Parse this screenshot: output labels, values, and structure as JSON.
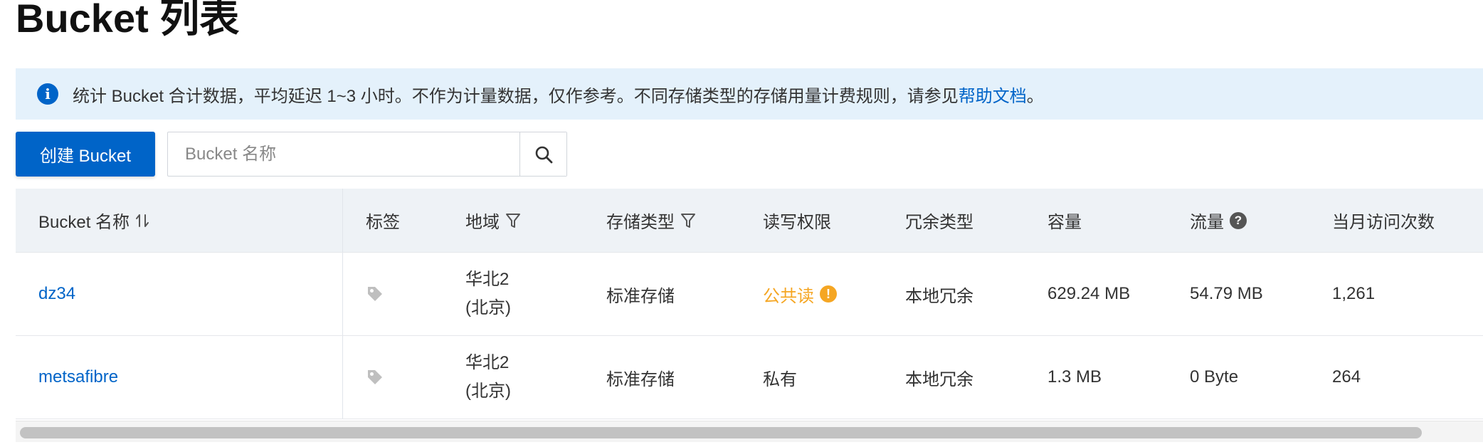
{
  "page_title": "Bucket 列表",
  "notice": {
    "text": "统计 Bucket 合计数据，平均延迟 1~3 小时。不作为计量数据，仅作参考。不同存储类型的存储用量计费规则，请参见",
    "link_text": "帮助文档",
    "suffix": "。",
    "icon": "info-icon"
  },
  "toolbar": {
    "create_label": "创建 Bucket",
    "search_placeholder": "Bucket 名称",
    "search_icon": "search-icon"
  },
  "table": {
    "columns": {
      "name": "Bucket 名称",
      "tag": "标签",
      "region": "地域",
      "storage_class": "存储类型",
      "acl": "读写权限",
      "redundancy": "冗余类型",
      "capacity": "容量",
      "traffic": "流量",
      "monthly_visits": "当月访问次数"
    },
    "rows": [
      {
        "name": "dz34",
        "region": "华北2 (北京)",
        "storage_class": "标准存储",
        "acl": "公共读",
        "acl_warning": true,
        "redundancy": "本地冗余",
        "capacity": "629.24 MB",
        "traffic": "54.79 MB",
        "monthly_visits": "1,261"
      },
      {
        "name": "metsafibre",
        "region": "华北2 (北京)",
        "storage_class": "标准存储",
        "acl": "私有",
        "acl_warning": false,
        "redundancy": "本地冗余",
        "capacity": "1.3 MB",
        "traffic": "0 Byte",
        "monthly_visits": "264"
      }
    ]
  },
  "colors": {
    "primary": "#0064c8",
    "notice_bg": "#e4f1fb",
    "warning": "#f5a623",
    "header_bg": "#eef2f6"
  }
}
